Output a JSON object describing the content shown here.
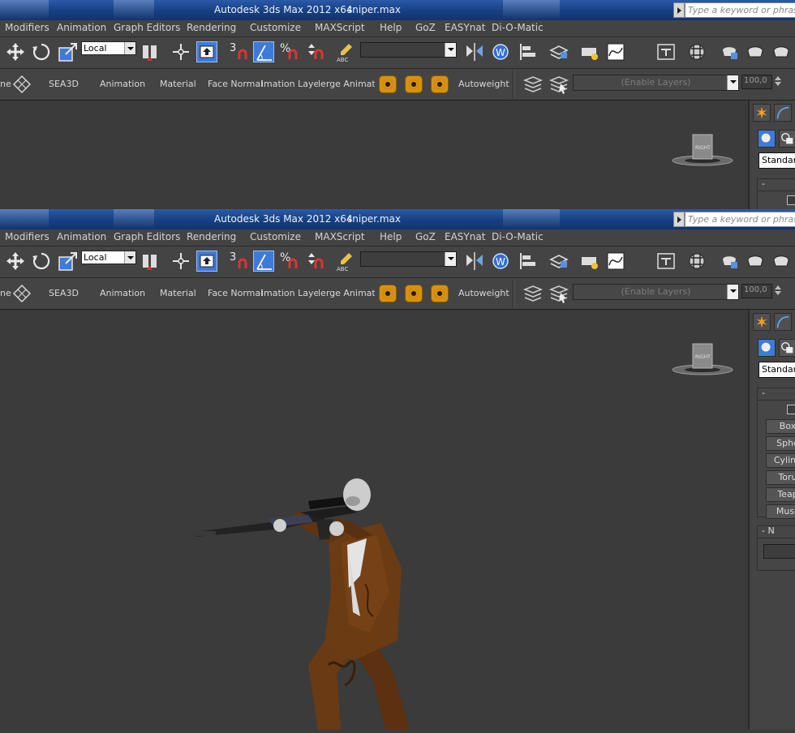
{
  "window": {
    "app_title": "Autodesk 3ds Max  2012 x64",
    "file_name": "sniper.max",
    "help_search_placeholder": "Type a keyword or phrase"
  },
  "menu": [
    "Modifiers",
    "Animation",
    "Graph Editors",
    "Rendering",
    "Customize",
    "MAXScript",
    "Help",
    "GoZ",
    "EASYnat",
    "Di-O-Matic"
  ],
  "toolbar": {
    "coord_system": "Local",
    "snap_labels": [
      "3",
      "%"
    ],
    "named_selection_value": ""
  },
  "plugin_toolbar": {
    "tabs": [
      "ne",
      "SEA3D",
      "Animation",
      "Material",
      "Face Normal",
      "imation Layers",
      "lerge Animatio",
      "Autoweight"
    ],
    "layers_placeholder": "(Enable Layers)",
    "spinner_value": "100,0"
  },
  "viewport": {
    "viewcube_label": "RIGHT"
  },
  "command_panel": {
    "object_type_dropdown": "Standard",
    "rollout_object_type": "-",
    "rollout_name_color": "- N",
    "object_buttons": [
      "Box",
      "Sphe",
      "Cylind",
      "Toru",
      "Teap",
      "Musc"
    ]
  },
  "colors": {
    "accent_blue": "#3e7ad8",
    "title_bar": "#1a4287",
    "ui_background": "#444444",
    "viewport_background": "#3b3b3b",
    "orange_buttons": "#d79111"
  }
}
